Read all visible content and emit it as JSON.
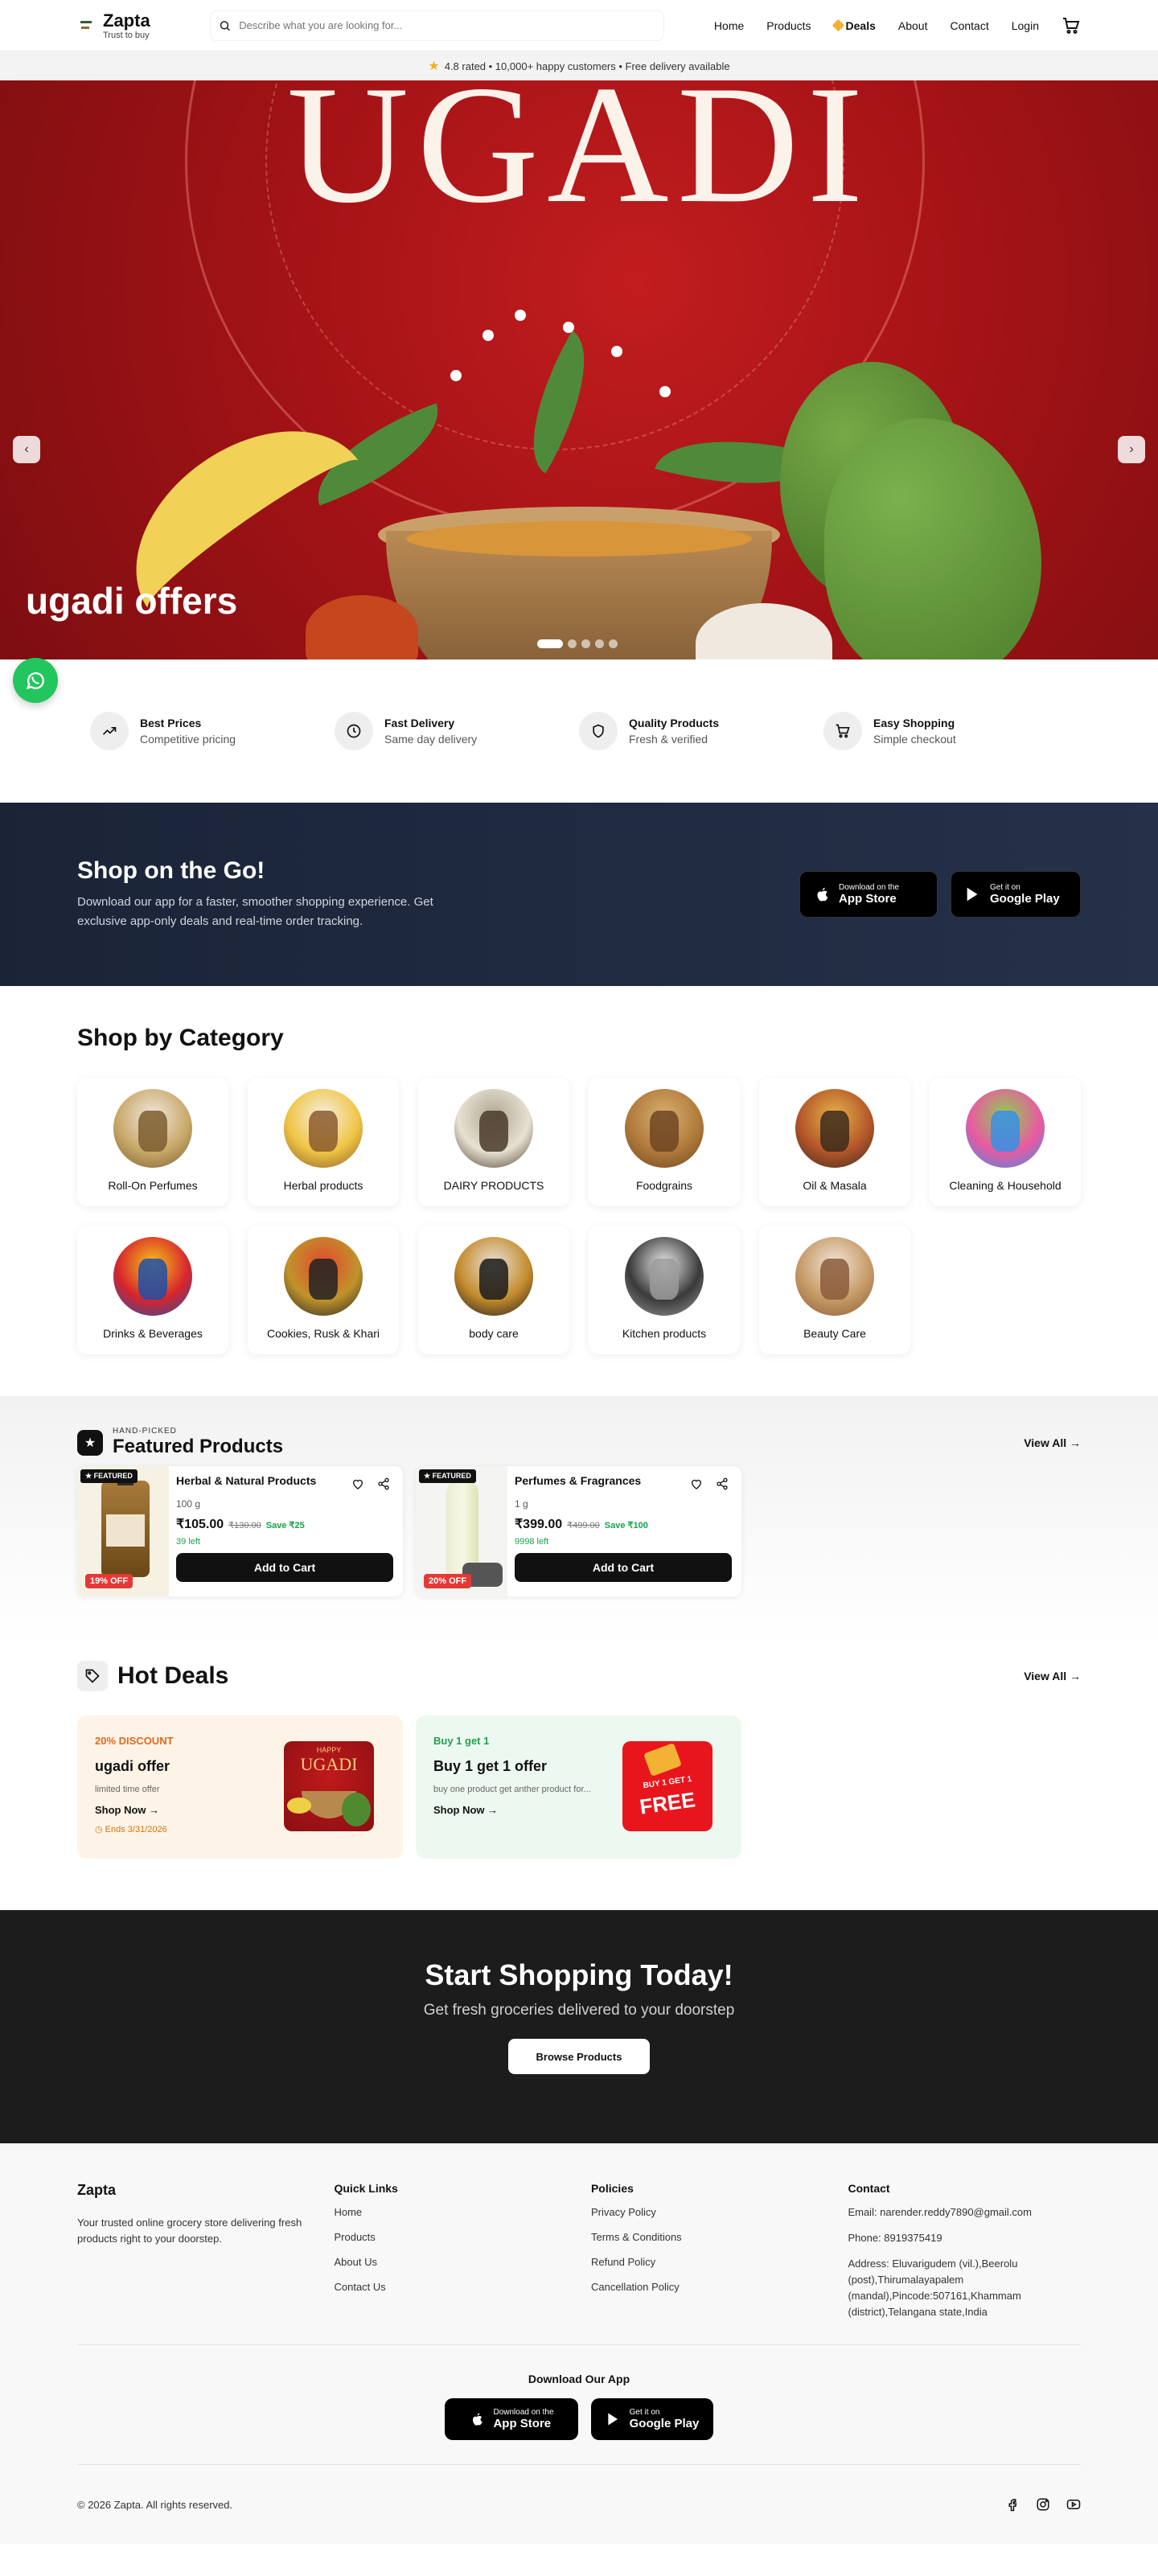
{
  "header": {
    "brand": "Zapta",
    "tagline": "Trust to buy",
    "search_placeholder": "Describe what you are looking for...",
    "nav": [
      "Home",
      "Products",
      "Deals",
      "About",
      "Contact",
      "Login"
    ]
  },
  "strip": {
    "text": "4.8 rated • 10,000+ happy customers • Free delivery available"
  },
  "hero": {
    "word": "UGADI",
    "caption": "ugadi offers",
    "slides": 5,
    "active_slide": 1
  },
  "features": [
    {
      "title": "Best Prices",
      "sub": "Competitive pricing",
      "icon": "trending-up-icon"
    },
    {
      "title": "Fast Delivery",
      "sub": "Same day delivery",
      "icon": "clock-icon"
    },
    {
      "title": "Quality Products",
      "sub": "Fresh & verified",
      "icon": "shield-icon"
    },
    {
      "title": "Easy Shopping",
      "sub": "Simple checkout",
      "icon": "cart-icon"
    }
  ],
  "app_band": {
    "title": "Shop on the Go!",
    "text": "Download our app for a faster, smoother shopping experience. Get exclusive app-only deals and real-time order tracking.",
    "appstore_small": "Download on the",
    "appstore_big": "App Store",
    "gplay_small": "Get it on",
    "gplay_big": "Google Play"
  },
  "categories": {
    "title": "Shop by Category",
    "items": [
      {
        "label": "Roll-On Perfumes",
        "colors": [
          "#c9a96a",
          "#7b5d2e",
          "#f1e8df"
        ]
      },
      {
        "label": "Herbal products",
        "colors": [
          "#f0c544",
          "#8b5a2b",
          "#f6efe6"
        ]
      },
      {
        "label": "DAIRY PRODUCTS",
        "colors": [
          "#e7e1d3",
          "#4a3b2b",
          "#b0a58f"
        ]
      },
      {
        "label": "Foodgrains",
        "colors": [
          "#b07a3b",
          "#6e4522",
          "#d9b070"
        ]
      },
      {
        "label": "Oil & Masala",
        "colors": [
          "#b4562a",
          "#3d2a1c",
          "#e6b347"
        ]
      },
      {
        "label": "Cleaning & Household",
        "colors": [
          "#e95aa1",
          "#3a8ee6",
          "#8ad14e"
        ]
      },
      {
        "label": "Drinks & Beverages",
        "colors": [
          "#d8242d",
          "#1d4fa8",
          "#f3c419"
        ]
      },
      {
        "label": "Cookies, Rusk & Khari",
        "colors": [
          "#c0932b",
          "#222222",
          "#e3482f"
        ]
      },
      {
        "label": "body care",
        "colors": [
          "#c38b2c",
          "#1a1a1a",
          "#e9e3da"
        ]
      },
      {
        "label": "Kitchen products",
        "colors": [
          "#3a3a3a",
          "#9b9b9b",
          "#eaeaea"
        ]
      },
      {
        "label": "Beauty Care",
        "colors": [
          "#c69a66",
          "#8a5b3a",
          "#f2e6da"
        ]
      }
    ]
  },
  "featured": {
    "kicker": "HAND-PICKED",
    "title": "Featured Products",
    "view_all": "View All →",
    "items": [
      {
        "tag": "FEATURED",
        "off": "19% OFF",
        "name": "Herbal & Natural Products",
        "qty": "100 g",
        "price": "₹105.00",
        "mrp": "₹130.00",
        "save": "Save ₹25",
        "left": "39 left",
        "cta": "Add to Cart"
      },
      {
        "tag": "FEATURED",
        "off": "20% OFF",
        "name": "Perfumes & Fragrances",
        "qty": "1 g",
        "price": "₹399.00",
        "mrp": "₹499.00",
        "save": "Save ₹100",
        "left": "9998 left",
        "cta": "Add to Cart"
      }
    ]
  },
  "hot_deals": {
    "title": "Hot Deals",
    "view_all": "View All →",
    "items": [
      {
        "kicker": "20% DISCOUNT",
        "title": "ugadi offer",
        "sub": "limited time offer",
        "shop": "Shop Now",
        "ends": "Ends 3/31/2026",
        "img_text": "UGADI",
        "img_small": "HAPPY"
      },
      {
        "kicker": "Buy 1 get 1",
        "title": "Buy 1 get 1 offer",
        "sub": "buy one product get anther product for...",
        "shop": "Shop Now",
        "img_text": "FREE",
        "img_small": "BUY 1 GET 1"
      }
    ],
    "colors": {
      "orange": "#e2671d",
      "green": "#22a04c"
    }
  },
  "cta": {
    "title": "Start Shopping Today!",
    "sub": "Get fresh groceries delivered to your doorstep",
    "button": "Browse Products"
  },
  "footer": {
    "brand": "Zapta",
    "desc": "Your trusted online grocery store delivering fresh products right to your doorstep.",
    "quick_title": "Quick Links",
    "quick": [
      "Home",
      "Products",
      "About Us",
      "Contact Us"
    ],
    "policy_title": "Policies",
    "policies": [
      "Privacy Policy",
      "Terms & Conditions",
      "Refund Policy",
      "Cancellation Policy"
    ],
    "contact_title": "Contact",
    "email": "Email: narender.reddy7890@gmail.com",
    "phone": "Phone: 8919375419",
    "address": "Address: Eluvarigudem (vil.),Beerolu (post),Thirumalayapalem (mandal),Pincode:507161,Khammam (district),Telangana state,India",
    "download_title": "Download Our App",
    "copyright": "© 2026 Zapta. All rights reserved."
  }
}
